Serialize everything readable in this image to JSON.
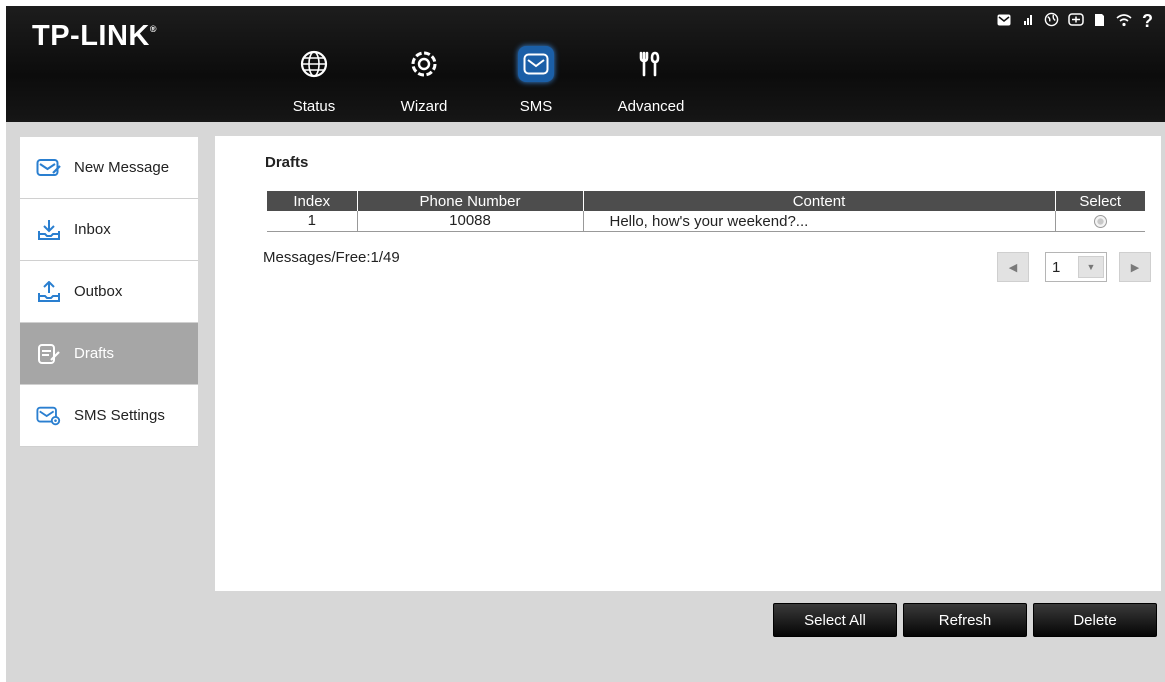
{
  "brand": {
    "name": "TP-LINK",
    "mark": "®"
  },
  "status_bar": [
    {
      "name": "envelope-icon",
      "glyph": "✉"
    },
    {
      "name": "signal-icon",
      "glyph": "▂▄"
    },
    {
      "name": "globe-icon",
      "glyph": "◍"
    },
    {
      "name": "battery-icon",
      "glyph": "⊟"
    },
    {
      "name": "sd-card-icon",
      "glyph": "▮"
    },
    {
      "name": "wifi-icon",
      "glyph": "≈"
    },
    {
      "name": "help-icon",
      "glyph": "?"
    }
  ],
  "nav": {
    "items": [
      {
        "label": "Status",
        "icon": "globe-icon"
      },
      {
        "label": "Wizard",
        "icon": "gear-icon"
      },
      {
        "label": "SMS",
        "icon": "envelope-icon",
        "active": true
      },
      {
        "label": "Advanced",
        "icon": "tools-icon"
      }
    ]
  },
  "sidebar": {
    "items": [
      {
        "label": "New Message",
        "icon": "new-message-icon"
      },
      {
        "label": "Inbox",
        "icon": "inbox-icon"
      },
      {
        "label": "Outbox",
        "icon": "outbox-icon"
      },
      {
        "label": "Drafts",
        "icon": "drafts-icon",
        "active": true
      },
      {
        "label": "SMS Settings",
        "icon": "sms-settings-icon"
      }
    ]
  },
  "main": {
    "title": "Drafts",
    "table": {
      "headers": [
        "Index",
        "Phone Number",
        "Content",
        "Select"
      ],
      "rows": [
        {
          "index": "1",
          "phone": "10088",
          "content": "Hello, how's your weekend?..."
        }
      ]
    },
    "free_count": "Messages/Free:1/49",
    "pager": {
      "current_page": "1"
    }
  },
  "actions": {
    "select_all": "Select All",
    "refresh": "Refresh",
    "delete": "Delete"
  },
  "colors": {
    "accent": "#1b5fa7",
    "header_bg": "#111111",
    "active_side": "#a6a6a6"
  }
}
